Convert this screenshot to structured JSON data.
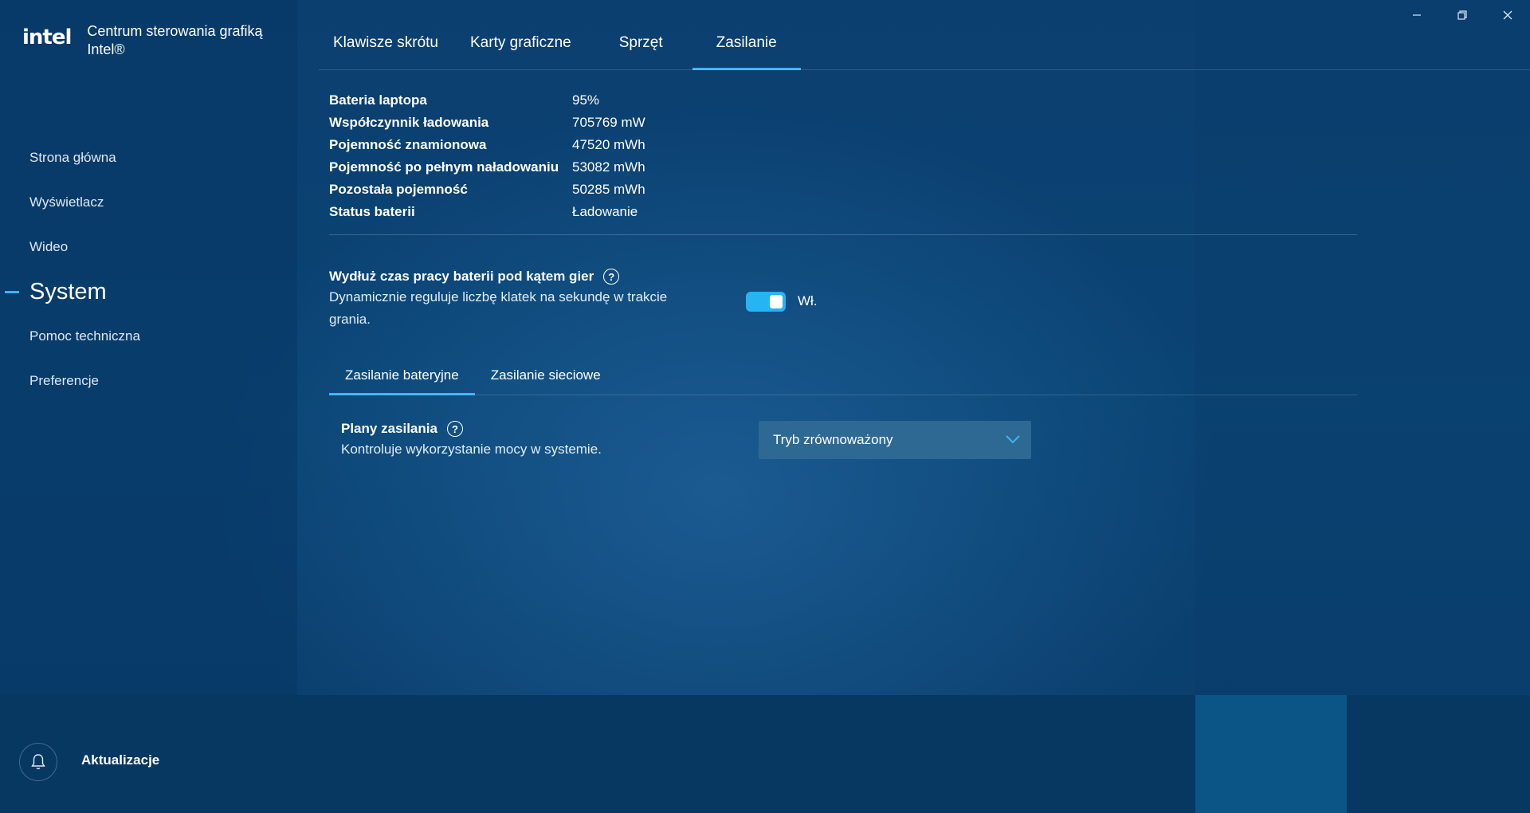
{
  "app": {
    "logo": "intel",
    "title": "Centrum sterowania grafiką Intel®"
  },
  "window_controls": {
    "minimize": "—",
    "restore": "❐",
    "close": "✕"
  },
  "sidebar": {
    "items": [
      {
        "label": "Strona główna"
      },
      {
        "label": "Wyświetlacz"
      },
      {
        "label": "Wideo"
      },
      {
        "label": "System",
        "active": true
      },
      {
        "label": "Pomoc techniczna"
      },
      {
        "label": "Preferencje"
      }
    ]
  },
  "tabs": [
    {
      "label": "Klawisze skrótu"
    },
    {
      "label": "Karty graficzne"
    },
    {
      "label": "Sprzęt"
    },
    {
      "label": "Zasilanie",
      "active": true
    }
  ],
  "battery": {
    "rows": [
      {
        "key": "Bateria laptopa",
        "value": "95%"
      },
      {
        "key": "Współczynnik ładowania",
        "value": "705769 mW"
      },
      {
        "key": "Pojemność znamionowa",
        "value": "47520 mWh"
      },
      {
        "key": "Pojemność po pełnym naładowaniu",
        "value": "53082 mWh"
      },
      {
        "key": "Pozostała pojemność",
        "value": "50285 mWh"
      },
      {
        "key": "Status baterii",
        "value": "Ładowanie"
      }
    ]
  },
  "extend_battery": {
    "title": "Wydłuż czas pracy baterii pod kątem gier",
    "description": "Dynamicznie reguluje liczbę klatek na sekundę w trakcie grania.",
    "toggle_on": true,
    "toggle_label": "Wł."
  },
  "subtabs": [
    {
      "label": "Zasilanie bateryjne",
      "active": true
    },
    {
      "label": "Zasilanie sieciowe"
    }
  ],
  "power_plans": {
    "title": "Plany zasilania",
    "description": "Kontroluje wykorzystanie mocy w systemie.",
    "selected": "Tryb zrównoważony"
  },
  "footer": {
    "updates_label": "Aktualizacje"
  },
  "colors": {
    "accent": "#3fb4f0",
    "toggle": "#27b4f2",
    "background": "#0a3b6a"
  }
}
